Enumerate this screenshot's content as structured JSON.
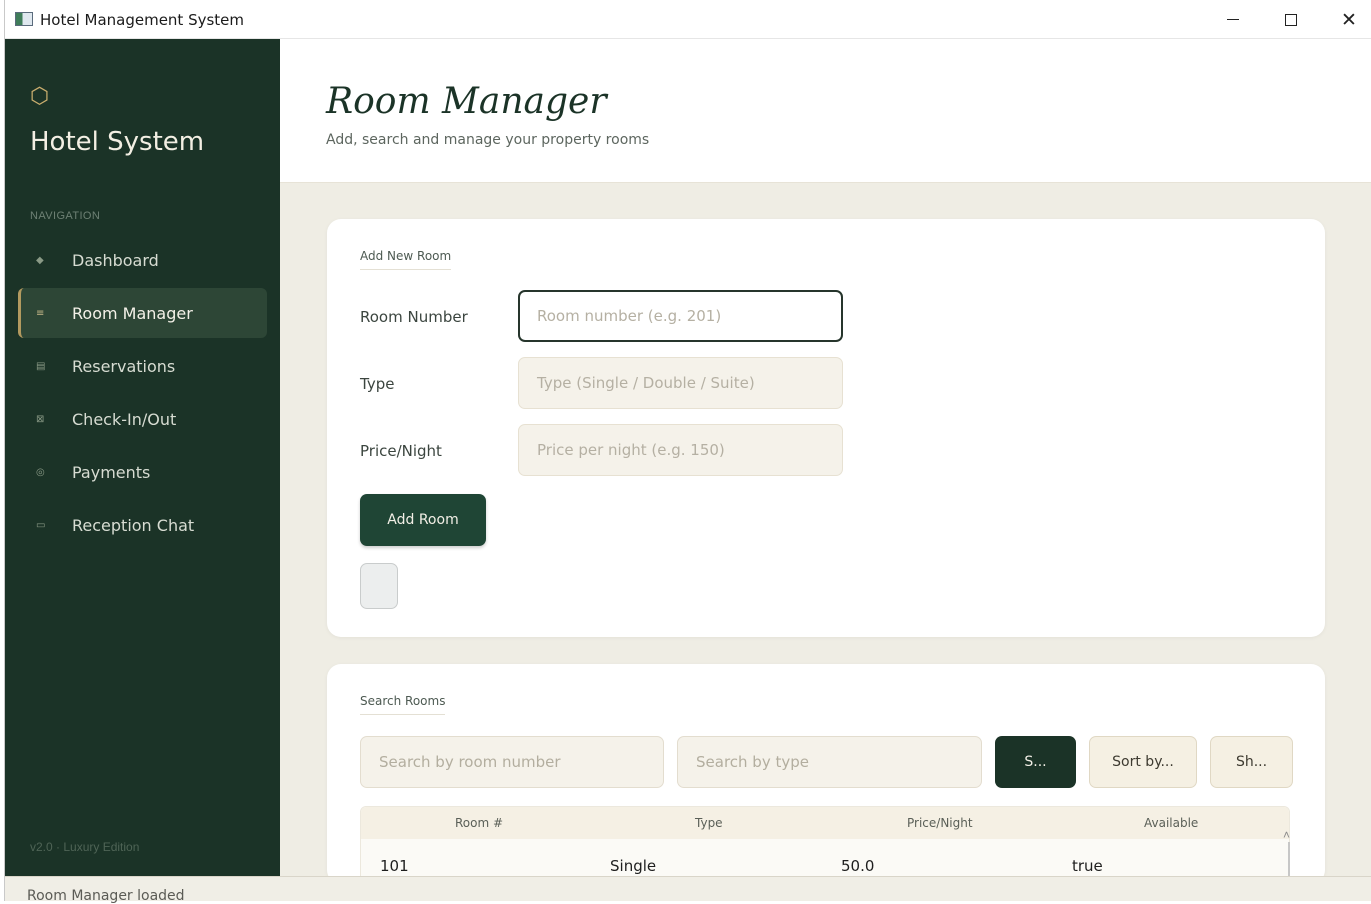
{
  "window": {
    "title": "Hotel Management System",
    "minimize_icon": "minimize-icon",
    "maximize_icon": "maximize-icon",
    "close_glyph": "✕"
  },
  "sidebar": {
    "logo_glyph": "⬡",
    "brand": "Hotel System",
    "heading": "NAVIGATION",
    "items": [
      {
        "label": "Dashboard",
        "icon": "◆",
        "active": false
      },
      {
        "label": "Room Manager",
        "icon": "≡",
        "active": true
      },
      {
        "label": "Reservations",
        "icon": "▤",
        "active": false
      },
      {
        "label": "Check-In/Out",
        "icon": "⊠",
        "active": false
      },
      {
        "label": "Payments",
        "icon": "◎",
        "active": false
      },
      {
        "label": "Reception Chat",
        "icon": "▭",
        "active": false
      }
    ],
    "version": "v2.0  ·  Luxury Edition"
  },
  "header": {
    "title": "Room Manager",
    "subtitle": "Add, search and manage your property rooms"
  },
  "add_room": {
    "section_title": "Add New Room",
    "room_number_label": "Room Number",
    "room_number_placeholder": "Room number  (e.g. 201)",
    "type_label": "Type",
    "type_placeholder": "Type  (Single / Double / Suite)",
    "price_label": "Price/Night",
    "price_placeholder": "Price per night  (e.g. 150)",
    "add_button": "Add Room"
  },
  "search": {
    "section_title": "Search Rooms",
    "room_number_placeholder": "Search by room number",
    "type_placeholder": "Search by type",
    "search_button": "S...",
    "sort_button": "Sort by...",
    "show_button": "Sh..."
  },
  "table": {
    "columns": [
      "Room #",
      "Type",
      "Price/Night",
      "Available"
    ],
    "rows": [
      [
        "101",
        "Single",
        "50.0",
        "true"
      ]
    ]
  },
  "status": "Room Manager loaded",
  "colors": {
    "sidebar_bg": "#1b3327",
    "accent_gold": "#b39a5f",
    "primary_button": "#1f4535",
    "content_bg": "#efede4"
  }
}
